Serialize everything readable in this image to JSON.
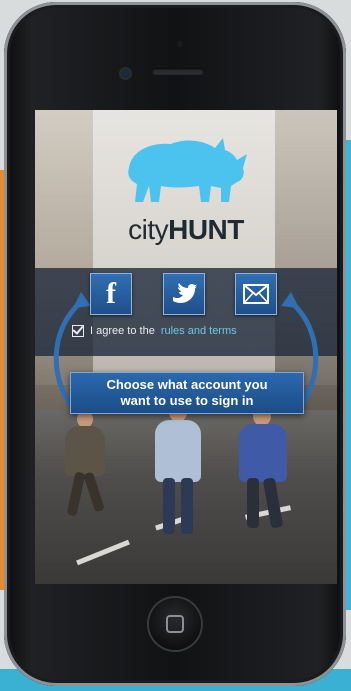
{
  "app": {
    "brand_light": "city",
    "brand_bold": "HUNT",
    "logo_icon": "rhino-icon",
    "accent_color": "#4cc3ee"
  },
  "signin": {
    "buttons": [
      {
        "id": "facebook",
        "glyph": "f",
        "icon": "facebook-icon"
      },
      {
        "id": "twitter",
        "icon": "twitter-bird-icon"
      },
      {
        "id": "email",
        "icon": "envelope-icon"
      }
    ],
    "agree_prefix": "I agree to the",
    "agree_link": "rules and terms",
    "agree_checked": true,
    "tooltip_line1": "Choose what account you",
    "tooltip_line2": "want to use to sign in"
  }
}
